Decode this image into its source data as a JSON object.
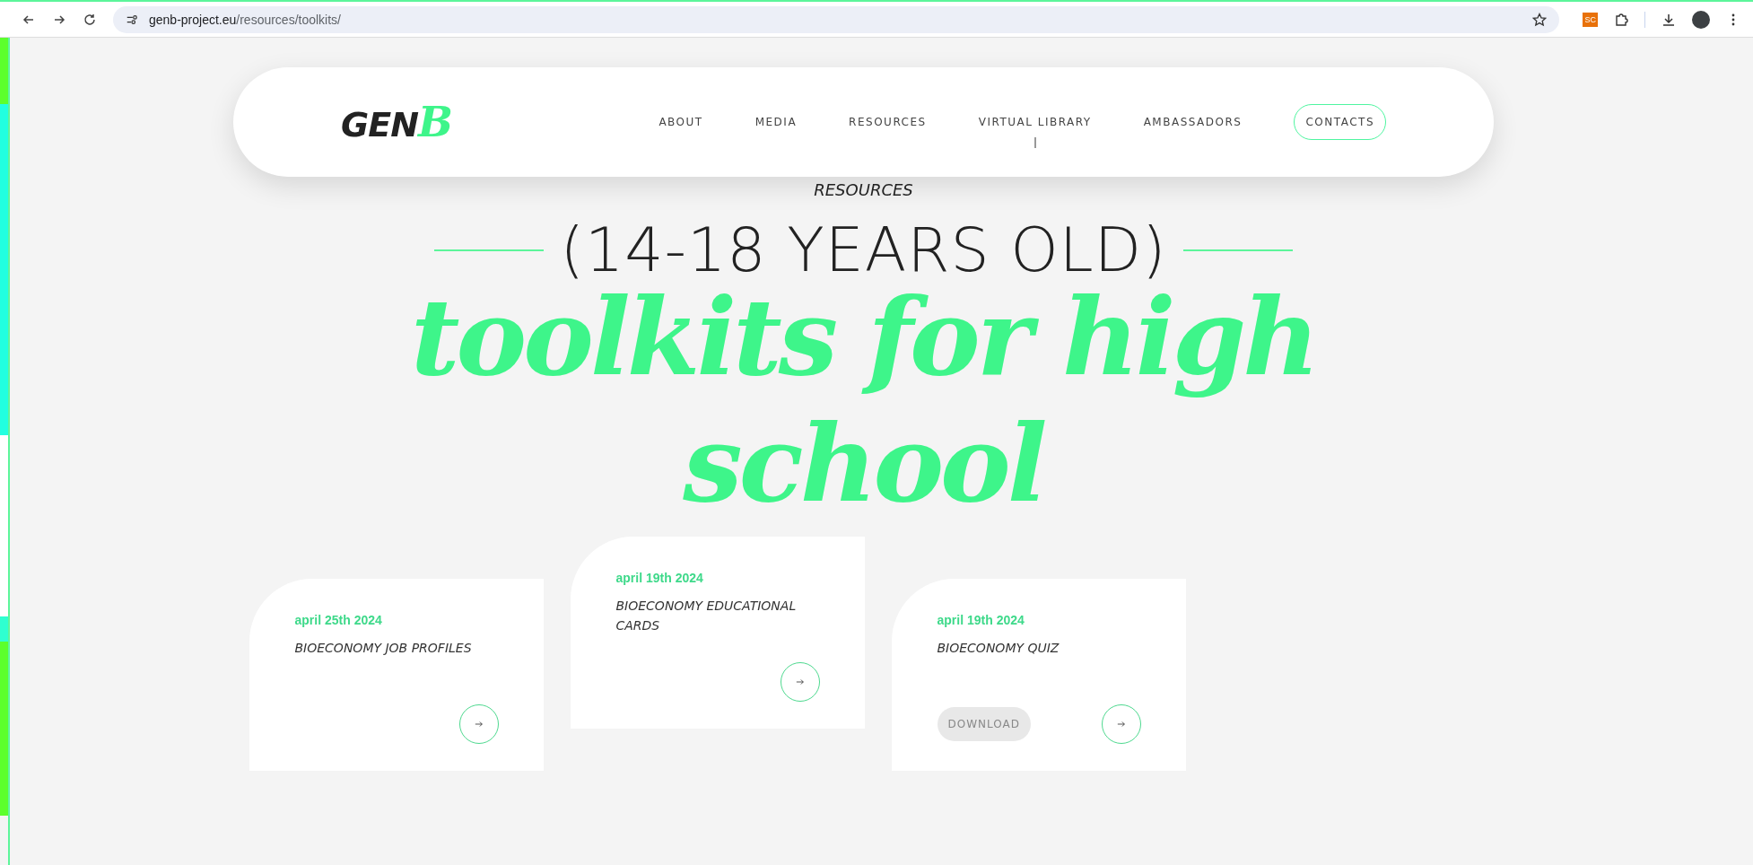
{
  "browser": {
    "url_host": "genb-project.eu",
    "url_path": "/resources/toolkits/",
    "extension_badge": "SC"
  },
  "nav": {
    "logo": {
      "text": "GEN",
      "accent": "B"
    },
    "items": [
      {
        "label": "ABOUT",
        "kind": "link"
      },
      {
        "label": "MEDIA",
        "kind": "link"
      },
      {
        "label": "RESOURCES",
        "kind": "link"
      },
      {
        "label": "VIRTUAL LIBRARY",
        "kind": "link"
      },
      {
        "label": "AMBASSADORS",
        "kind": "link"
      },
      {
        "label": "CONTACTS",
        "kind": "outlined"
      }
    ]
  },
  "breadcrumb": "RESOURCES",
  "subtitle": "(14-18 YEARS OLD)",
  "title": "toolkits for high school",
  "cards": [
    {
      "date": "april 25th 2024",
      "title": "BIOECONOMY JOB PROFILES"
    },
    {
      "date": "april 19th 2024",
      "title": "BIOECONOMY EDUCATIONAL CARDS"
    },
    {
      "date": "april 19th 2024",
      "title": "BIOECONOMY QUIZ",
      "download": "DOWNLOAD"
    }
  ]
}
